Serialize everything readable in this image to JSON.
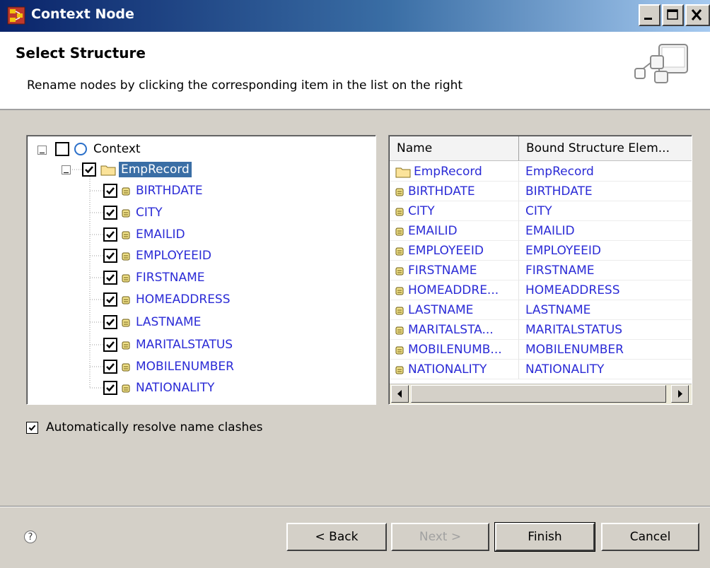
{
  "window": {
    "title": "Context Node",
    "icon": "context-node-app-icon"
  },
  "header": {
    "title": "Select Structure",
    "description": "Rename nodes by clicking the corresponding item in the list on the right"
  },
  "tree": {
    "root": {
      "label": "Context",
      "checked": false,
      "icon": "circle-context-icon"
    },
    "node": {
      "label": "EmpRecord",
      "checked": true,
      "icon": "folder-icon"
    },
    "items": [
      {
        "label": "BIRTHDATE",
        "checked": true
      },
      {
        "label": "CITY",
        "checked": true
      },
      {
        "label": "EMAILID",
        "checked": true
      },
      {
        "label": "EMPLOYEEID",
        "checked": true
      },
      {
        "label": "FIRSTNAME",
        "checked": true
      },
      {
        "label": "HOMEADDRESS",
        "checked": true
      },
      {
        "label": "LASTNAME",
        "checked": true
      },
      {
        "label": "MARITALSTATUS",
        "checked": true
      },
      {
        "label": "MOBILENUMBER",
        "checked": true
      },
      {
        "label": "NATIONALITY",
        "checked": true
      }
    ]
  },
  "table": {
    "columns": [
      "Name",
      "Bound Structure Elem..."
    ],
    "rows": [
      {
        "name": "EmpRecord",
        "bound": "EmpRecord",
        "icon": "folder-icon"
      },
      {
        "name": "BIRTHDATE",
        "bound": "BIRTHDATE",
        "icon": "attribute-icon"
      },
      {
        "name": "CITY",
        "bound": "CITY",
        "icon": "attribute-icon"
      },
      {
        "name": "EMAILID",
        "bound": "EMAILID",
        "icon": "attribute-icon"
      },
      {
        "name": "EMPLOYEEID",
        "bound": "EMPLOYEEID",
        "icon": "attribute-icon"
      },
      {
        "name": "FIRSTNAME",
        "bound": "FIRSTNAME",
        "icon": "attribute-icon"
      },
      {
        "name": "HOMEADDRE...",
        "bound": "HOMEADDRESS",
        "icon": "attribute-icon"
      },
      {
        "name": "LASTNAME",
        "bound": "LASTNAME",
        "icon": "attribute-icon"
      },
      {
        "name": "MARITALSTA...",
        "bound": "MARITALSTATUS",
        "icon": "attribute-icon"
      },
      {
        "name": "MOBILENUMB...",
        "bound": "MOBILENUMBER",
        "icon": "attribute-icon"
      },
      {
        "name": "NATIONALITY",
        "bound": "NATIONALITY",
        "icon": "attribute-icon"
      }
    ]
  },
  "options": {
    "auto_resolve_label": "Automatically resolve name clashes",
    "auto_resolve_checked": true
  },
  "buttons": {
    "back": "< Back",
    "next": "Next >",
    "finish": "Finish",
    "cancel": "Cancel"
  },
  "colors": {
    "link_text": "#2b2bd6",
    "selection": "#3a6ea5",
    "titlebar": "#0a246a",
    "dialog_bg": "#d4d0c8"
  }
}
